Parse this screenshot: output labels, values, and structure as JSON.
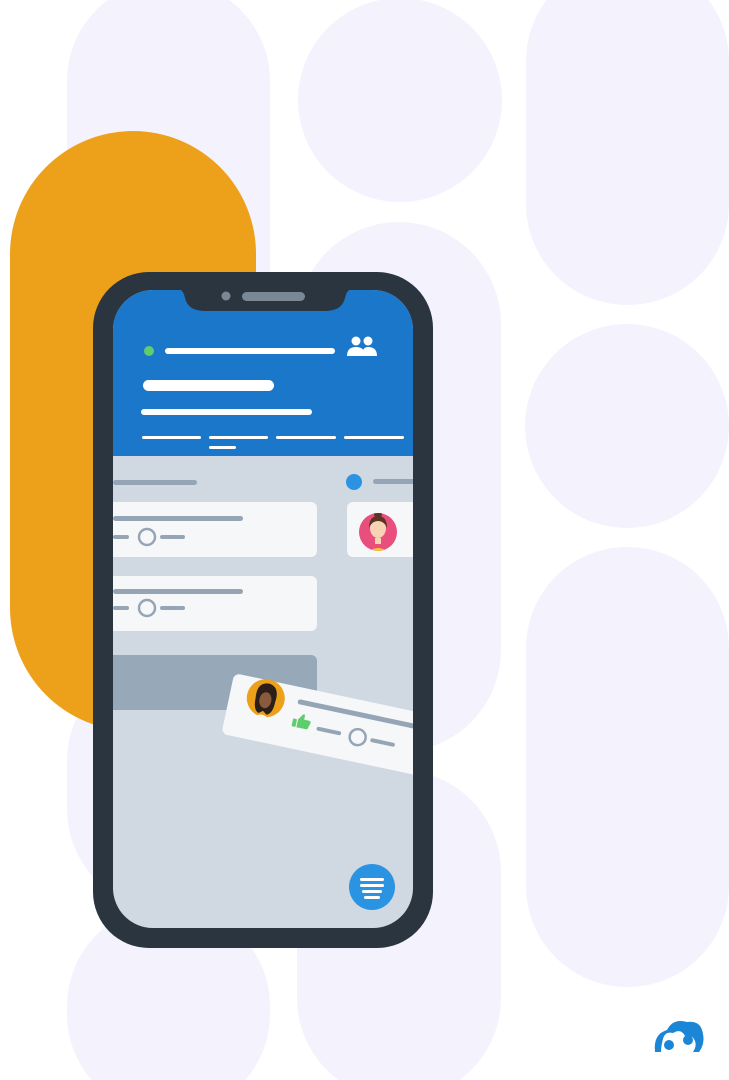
{
  "colors": {
    "page_background": "#ffffff",
    "background_shapes": "#f4f3fd",
    "accent_orange": "#eda11a",
    "phone_frame": "#2a3540",
    "app_header_blue": "#1b77c9",
    "app_body": "#d0d8e1",
    "card": "#f6f7f9",
    "skeleton_line": "#96a5b5",
    "notch_dots": "#7a8794",
    "online_green": "#5fcd6e",
    "thumbs_up_green": "#5fcd6e",
    "fab_blue": "#2a93e2",
    "logo_blue": "#1c86d6"
  },
  "icons": {
    "header_people": "people-icon",
    "fab": "menu-lines-icon",
    "card_reaction": "thumbs-up-icon",
    "brand": "cloud-people-logo"
  },
  "app": {
    "header_tabs_count": 4,
    "active_tab_index": 1
  }
}
